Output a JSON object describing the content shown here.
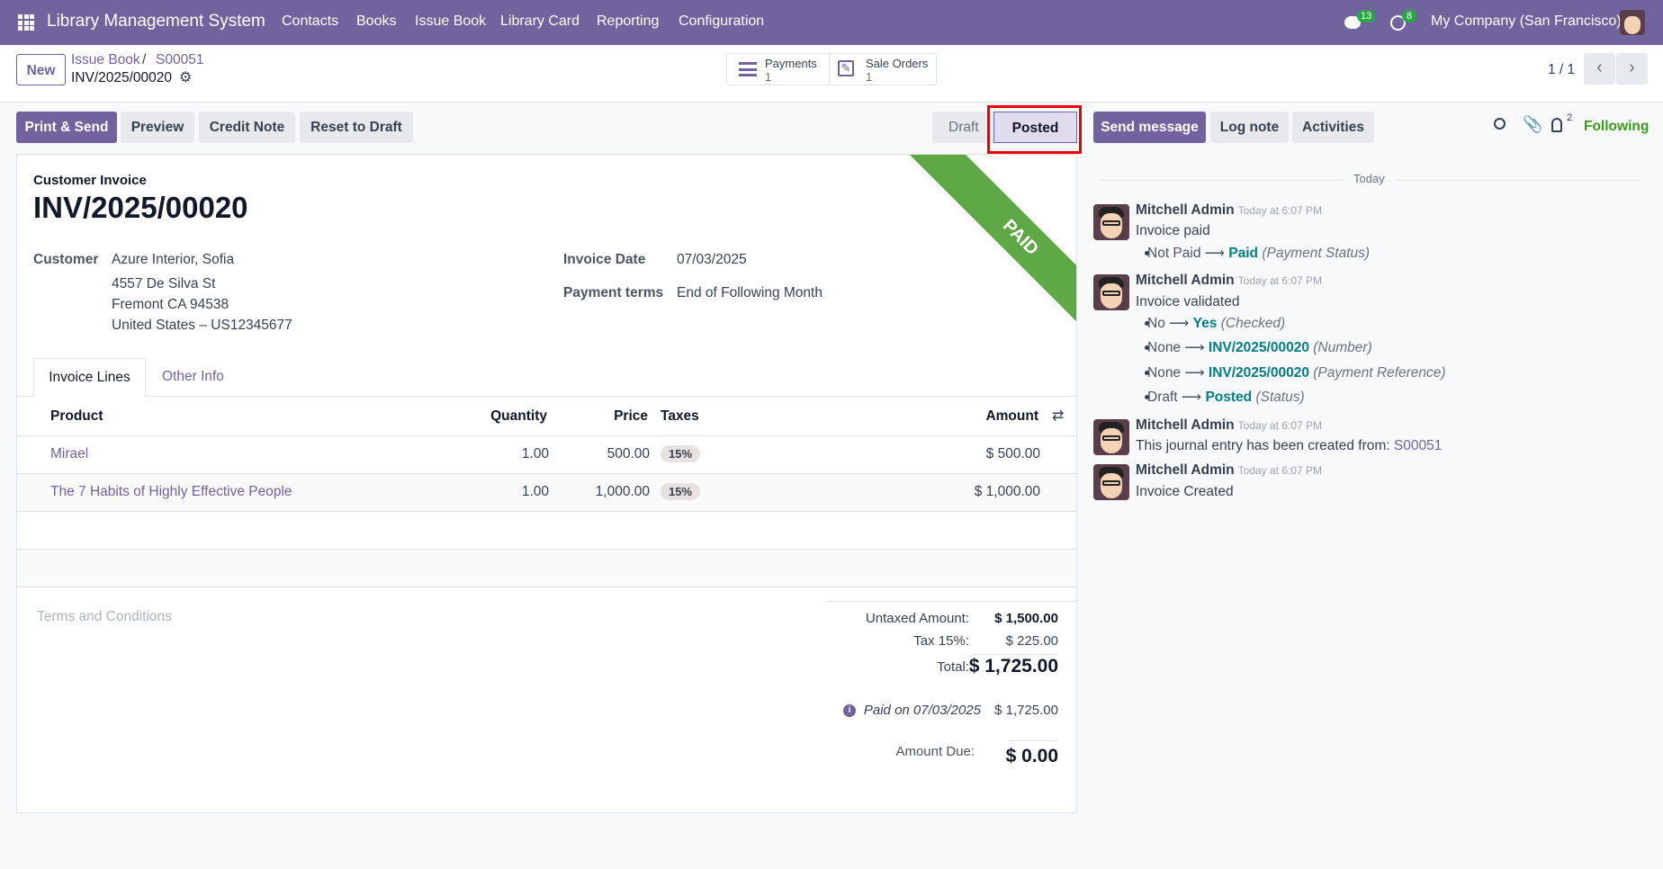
{
  "navbar": {
    "app_title": "Library Management System",
    "menu": [
      "Contacts",
      "Books",
      "Issue Book",
      "Library Card",
      "Reporting",
      "Configuration"
    ],
    "messages_count": "13",
    "activities_count": "8",
    "company": "My Company (San Francisco)"
  },
  "control_panel": {
    "new_label": "New",
    "breadcrumb_parent": "Issue Book",
    "breadcrumb_sep": "/",
    "breadcrumb_order": "S00051",
    "record_name": "INV/2025/00020",
    "smart_buttons": [
      {
        "label": "Payments",
        "value": "1"
      },
      {
        "label": "Sale Orders",
        "value": "1"
      }
    ],
    "pager": "1 / 1"
  },
  "actions": {
    "print_send": "Print & Send",
    "preview": "Preview",
    "credit_note": "Credit Note",
    "reset_draft": "Reset to Draft"
  },
  "statusbar": {
    "stages": [
      "Draft",
      "Posted"
    ],
    "current": "Posted"
  },
  "chatter_actions": {
    "send_message": "Send message",
    "log_note": "Log note",
    "activities": "Activities",
    "followers_count": "2",
    "following": "Following"
  },
  "form": {
    "type_label": "Customer Invoice",
    "number": "INV/2025/00020",
    "ribbon": "PAID",
    "customer_label": "Customer",
    "customer": "Azure Interior, Sofia",
    "address": [
      "4557 De Silva St",
      "Fremont CA 94538",
      "United States – US12345677"
    ],
    "invoice_date_label": "Invoice Date",
    "invoice_date": "07/03/2025",
    "payment_terms_label": "Payment terms",
    "payment_terms": "End of Following Month",
    "tabs": [
      "Invoice Lines",
      "Other Info"
    ],
    "columns": [
      "Product",
      "Quantity",
      "Price",
      "Taxes",
      "Amount"
    ],
    "lines": [
      {
        "product": "Mirael",
        "quantity": "1.00",
        "price": "500.00",
        "tax": "15%",
        "amount": "$ 500.00"
      },
      {
        "product": "The 7 Habits of Highly Effective People",
        "quantity": "1.00",
        "price": "1,000.00",
        "tax": "15%",
        "amount": "$ 1,000.00"
      }
    ],
    "terms_placeholder": "Terms and Conditions",
    "totals": {
      "untaxed_label": "Untaxed Amount:",
      "untaxed": "$ 1,500.00",
      "tax_label": "Tax 15%:",
      "tax": "$ 225.00",
      "total_label": "Total:",
      "total": "$ 1,725.00",
      "paid_label": "Paid on 07/03/2025",
      "paid": "$ 1,725.00",
      "due_label": "Amount Due:",
      "due": "$ 0.00"
    }
  },
  "chatter": {
    "date_sep": "Today",
    "messages": [
      {
        "author": "Mitchell Admin",
        "time": "Today at 6:07 PM",
        "body": "Invoice paid",
        "changes": [
          {
            "old": "Not Paid",
            "new": "Paid",
            "field": "(Payment Status)"
          }
        ]
      },
      {
        "author": "Mitchell Admin",
        "time": "Today at 6:07 PM",
        "body": "Invoice validated",
        "changes": [
          {
            "old": "No",
            "new": "Yes",
            "field": "(Checked)"
          },
          {
            "old": "None",
            "new": "INV/2025/00020",
            "field": "(Number)"
          },
          {
            "old": "None",
            "new": "INV/2025/00020",
            "field": "(Payment Reference)"
          },
          {
            "old": "Draft",
            "new": "Posted",
            "field": "(Status)"
          }
        ]
      },
      {
        "author": "Mitchell Admin",
        "time": "Today at 6:07 PM",
        "body": "This journal entry has been created from:",
        "link": "S00051"
      },
      {
        "author": "Mitchell Admin",
        "time": "Today at 6:07 PM",
        "body": "Invoice Created"
      }
    ]
  }
}
